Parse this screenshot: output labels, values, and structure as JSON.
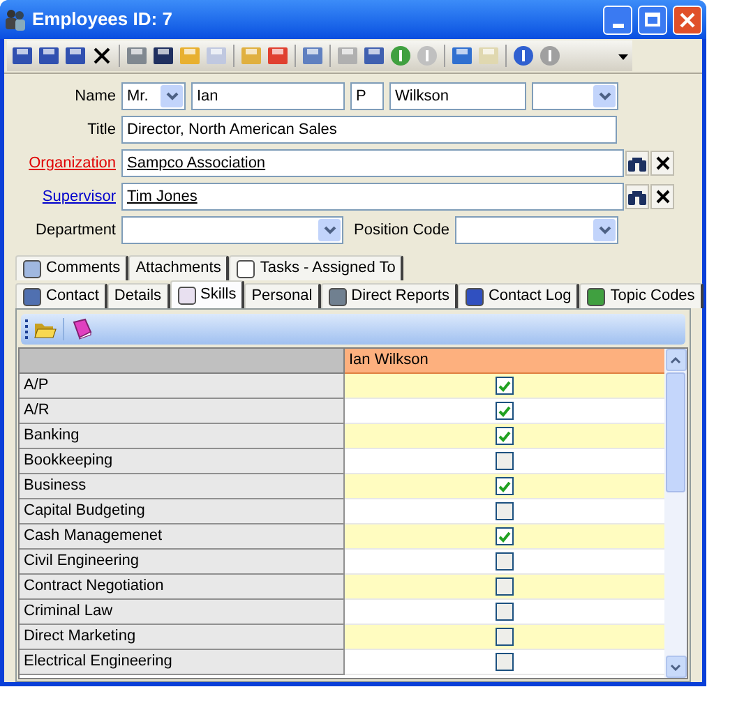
{
  "window": {
    "title": "Employees ID: 7"
  },
  "form": {
    "name": {
      "label": "Name",
      "salutation": "Mr.",
      "first": "Ian",
      "middle": "P",
      "last": "Wilkson"
    },
    "title": {
      "label": "Title",
      "value": "Director, North American Sales"
    },
    "organization": {
      "label": "Organization",
      "value": "Sampco Association"
    },
    "supervisor": {
      "label": "Supervisor",
      "value": "Tim Jones"
    },
    "department": {
      "label": "Department"
    },
    "position_code": {
      "label": "Position Code"
    }
  },
  "tabs_top": [
    {
      "label": "Comments",
      "selected": false
    },
    {
      "label": "Attachments",
      "selected": false
    },
    {
      "label": "Tasks - Assigned To",
      "selected": false
    }
  ],
  "tabs": [
    {
      "label": "Contact",
      "selected": false
    },
    {
      "label": "Details",
      "selected": false
    },
    {
      "label": "Skills",
      "selected": true
    },
    {
      "label": "Personal",
      "selected": false
    },
    {
      "label": "Direct Reports",
      "selected": false
    },
    {
      "label": "Contact Log",
      "selected": false
    },
    {
      "label": "Topic Codes",
      "selected": false
    }
  ],
  "grid": {
    "column": "Ian Wilkson",
    "rows": [
      {
        "skill": "A/P",
        "checked": true
      },
      {
        "skill": "A/R",
        "checked": true
      },
      {
        "skill": "Banking",
        "checked": true
      },
      {
        "skill": "Bookkeeping",
        "checked": false
      },
      {
        "skill": "Business",
        "checked": true
      },
      {
        "skill": "Capital Budgeting",
        "checked": false
      },
      {
        "skill": "Cash Managemenet",
        "checked": true
      },
      {
        "skill": "Civil Engineering",
        "checked": false
      },
      {
        "skill": "Contract Negotiation",
        "checked": false
      },
      {
        "skill": "Criminal Law",
        "checked": false
      },
      {
        "skill": "Direct Marketing",
        "checked": false
      },
      {
        "skill": "Electrical Engineering",
        "checked": false
      }
    ]
  }
}
